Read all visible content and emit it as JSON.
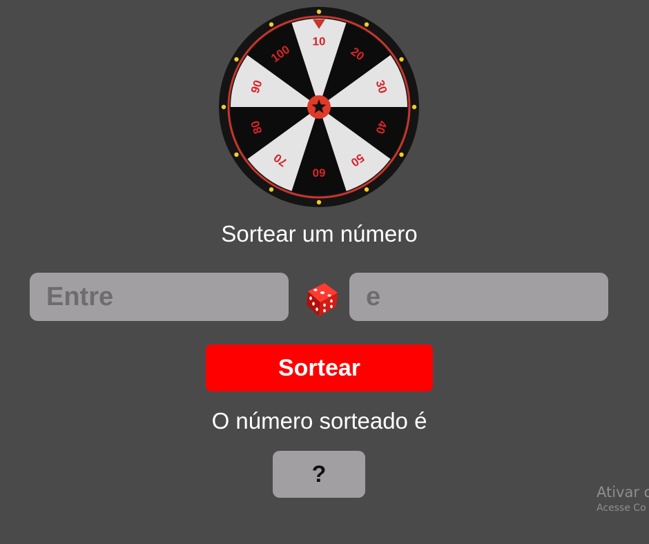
{
  "wheel": {
    "labels": [
      "10",
      "20",
      "30",
      "40",
      "50",
      "60",
      "70",
      "80",
      "90",
      "100"
    ],
    "center_icon": "star-icon",
    "pointer_icon": "triangle-pointer-icon",
    "colors": {
      "rim": "#141414",
      "ring": "#c8352b",
      "dark_segment": "#0c0c0c",
      "light_segment": "#e4e4e4",
      "label": "#d8232a",
      "hub": "#e03a28",
      "bulb": "#f3cc2e"
    }
  },
  "title": "Sortear um número",
  "inputs": {
    "min_placeholder": "Entre",
    "max_placeholder": "e",
    "min_value": "",
    "max_value": ""
  },
  "dice_icon": "dice-icon",
  "draw_button_label": "Sortear",
  "result": {
    "label": "O número sorteado é",
    "value": "?"
  },
  "watermark": {
    "title": "Ativar o",
    "subtitle": "Acesse Co"
  },
  "colors": {
    "background": "#4a4a4a",
    "field": "#a19fa2",
    "button": "#ff0000",
    "text": "#ffffff"
  }
}
